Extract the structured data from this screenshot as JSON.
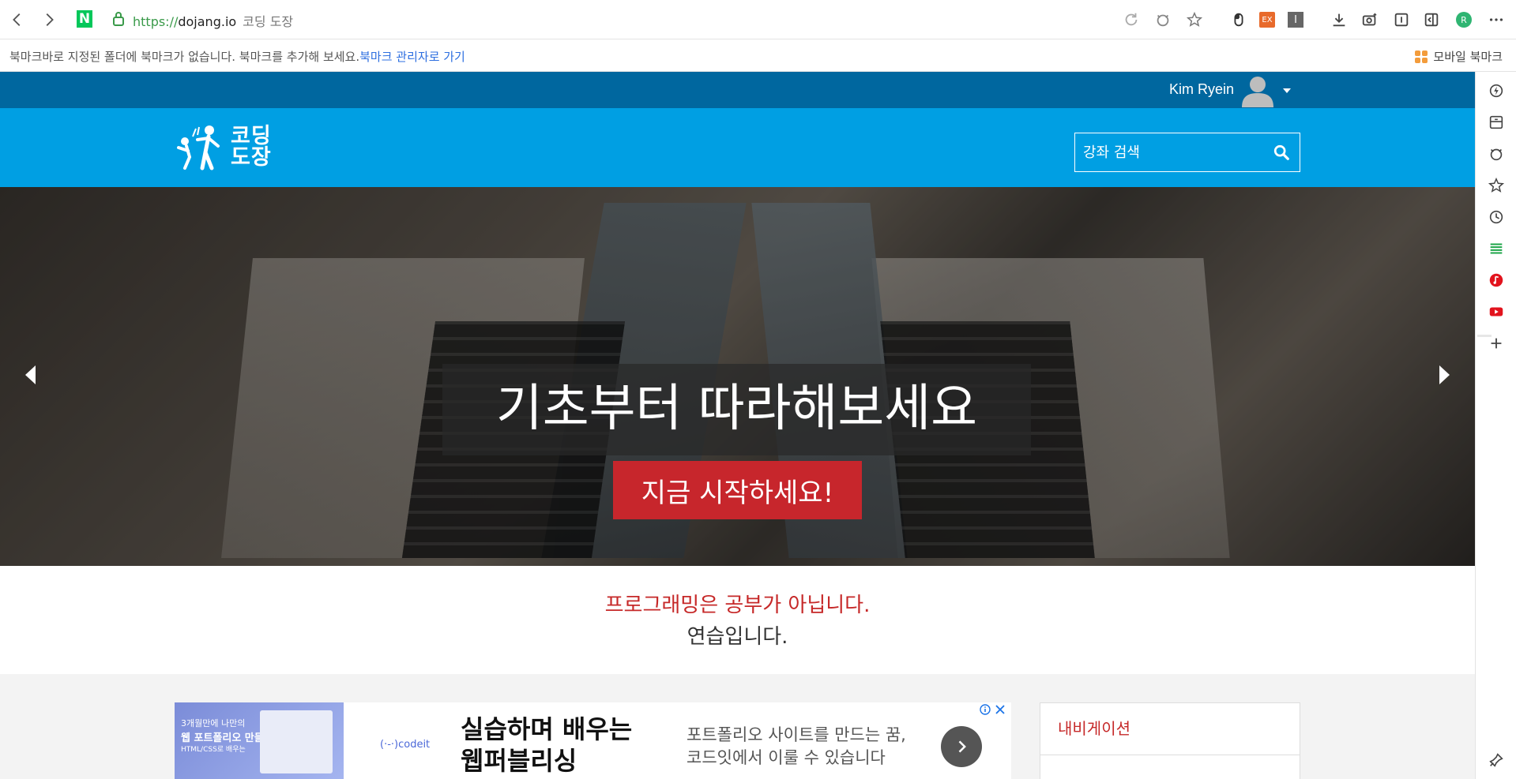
{
  "browser": {
    "url_protocol": "https://",
    "url_domain": "dojang.io",
    "page_title": "코딩 도장",
    "extension_ex_label": "EX",
    "profile_initial": "R"
  },
  "bookmarks_bar": {
    "message": "북마크바로 지정된 폴더에 북마크가 없습니다. 북마크를 추가해 보세요.",
    "manager_link": "북마크 관리자로 가기",
    "mobile_bookmarks": "모바일 북마크"
  },
  "site": {
    "user_name": "Kim Ryein",
    "logo_line1": "코딩",
    "logo_line2": "도장",
    "search_placeholder": "강좌 검색",
    "hero_caption": "기초부터 따라해보세요",
    "hero_cta": "지금 시작하세요!",
    "tagline_1": "프로그래밍은 공부가 아닙니다.",
    "tagline_2": "연습입니다.",
    "navigation_title": "내비게이션"
  },
  "ad": {
    "thumb_line1": "3개월만에 나만의",
    "thumb_line2": "웹 포트폴리오 만들기",
    "thumb_line3": "HTML/CSS로 배우는",
    "brand": "(·-·)codeit",
    "headline_1": "실습하며 배우는",
    "headline_2": "웹퍼블리싱",
    "body_1": "포트폴리오 사이트를 만드는 꿈,",
    "body_2": "코드잇에서 이룰 수 있습니다"
  },
  "colors": {
    "userbar": "#00679f",
    "header": "#009fe3",
    "cta": "#c7262c",
    "tagline_red": "#c62828"
  }
}
